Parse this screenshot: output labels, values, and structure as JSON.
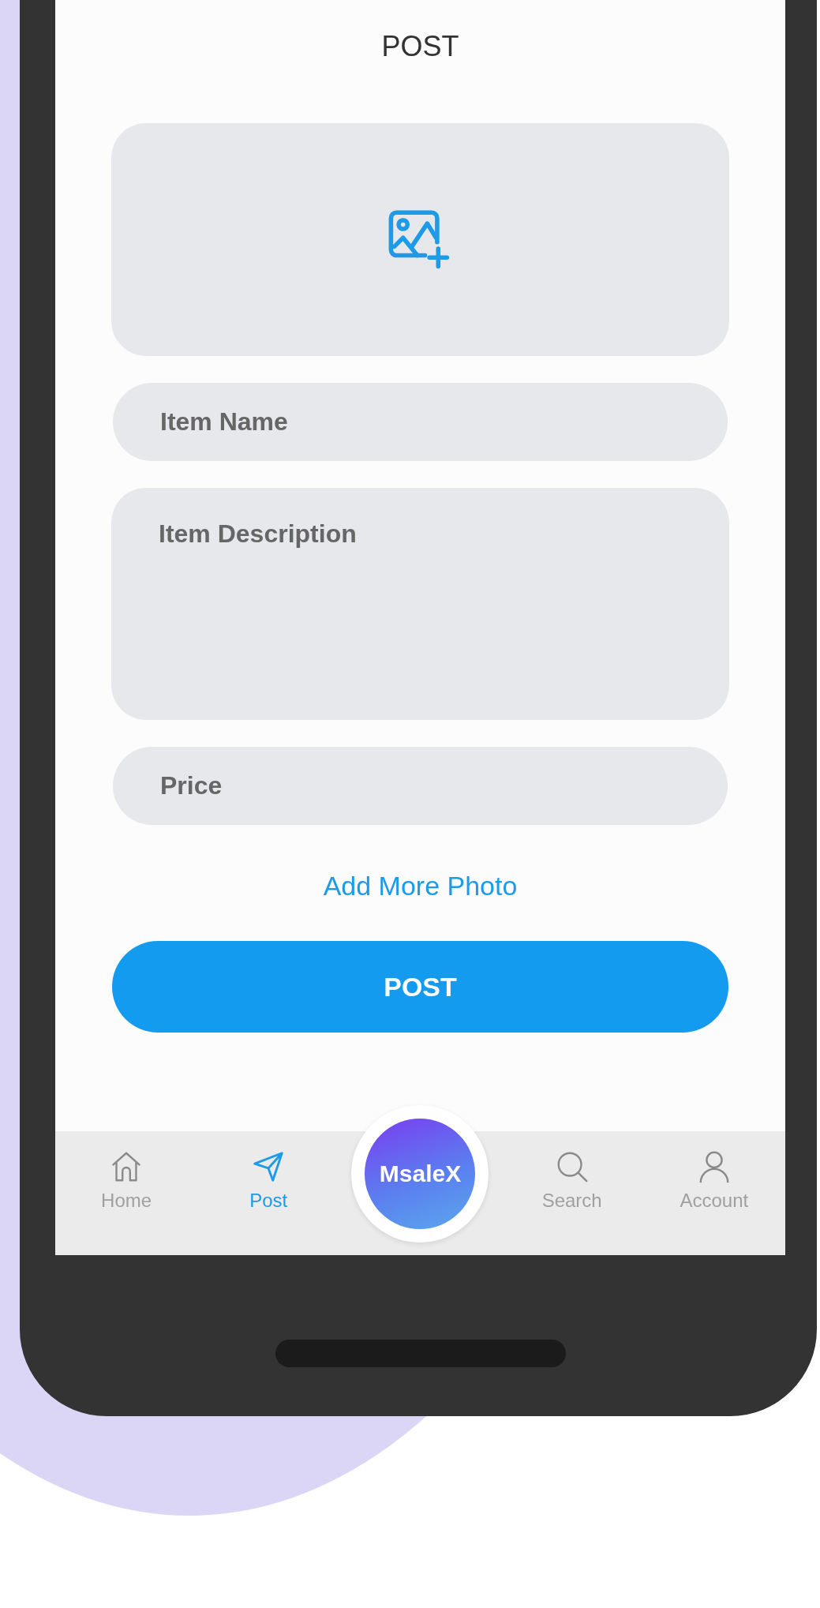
{
  "screen": {
    "title": "POST"
  },
  "fields": [
    {
      "kind": "line",
      "placeholder": "Item Name"
    },
    {
      "kind": "area",
      "placeholder": "Item Description"
    },
    {
      "kind": "line",
      "placeholder": "Price"
    }
  ],
  "add_more_link": "Add More Photo",
  "submit_button": "POST",
  "bottom_nav": [
    {
      "kind": "home",
      "label": "Home",
      "selected": false
    },
    {
      "kind": "post",
      "label": "Post",
      "selected": true
    },
    {
      "kind": "logo",
      "label": "MsaleX"
    },
    {
      "kind": "search",
      "label": "Search",
      "selected": false
    },
    {
      "kind": "account",
      "label": "Account",
      "selected": false
    }
  ]
}
